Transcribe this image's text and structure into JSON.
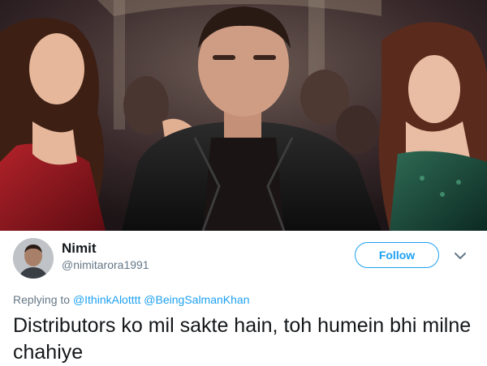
{
  "photo": {
    "alt_icon": "film-still-image"
  },
  "tweet": {
    "display_name": "Nimit",
    "handle": "@nimitarora1991",
    "follow_label": "Follow",
    "replying_prefix": "Replying to",
    "mentions": [
      "@IthinkAlotttt",
      "@BeingSalmanKhan"
    ],
    "text": "Distributors ko mil sakte hain, toh humein bhi milne chahiye"
  },
  "colors": {
    "accent": "#1da1f2",
    "text_primary": "#14171a",
    "text_secondary": "#657786"
  }
}
